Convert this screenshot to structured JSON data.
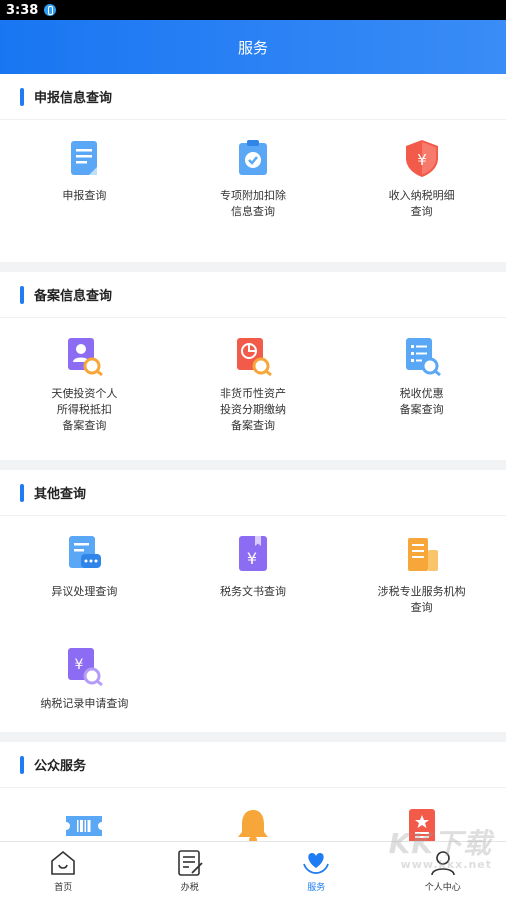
{
  "status": {
    "time": "3:38"
  },
  "header": {
    "title": "服务"
  },
  "sections": [
    {
      "title": "申报信息查询",
      "items": [
        {
          "label": "申报查询",
          "icon": "document-icon"
        },
        {
          "label": "专项附加扣除\n信息查询",
          "icon": "clipboard-check-icon"
        },
        {
          "label": "收入纳税明细\n查询",
          "icon": "shield-yen-icon"
        }
      ]
    },
    {
      "title": "备案信息查询",
      "items": [
        {
          "label": "天使投资个人\n所得税抵扣\n备案查询",
          "icon": "person-search-icon"
        },
        {
          "label": "非货币性资产\n投资分期缴纳\n备案查询",
          "icon": "pie-search-icon"
        },
        {
          "label": "税收优惠\n备案查询",
          "icon": "list-search-icon"
        }
      ]
    },
    {
      "title": "其他查询",
      "items": [
        {
          "label": "异议处理查询",
          "icon": "chat-document-icon"
        },
        {
          "label": "税务文书查询",
          "icon": "yen-book-icon"
        },
        {
          "label": "涉税专业服务机构\n查询",
          "icon": "building-icon"
        },
        {
          "label": "纳税记录申请查询",
          "icon": "yen-search-icon"
        }
      ]
    },
    {
      "title": "公众服务",
      "items": [
        {
          "label": "",
          "icon": "ticket-barcode-icon"
        },
        {
          "label": "",
          "icon": "bell-icon"
        },
        {
          "label": "",
          "icon": "star-document-icon"
        }
      ]
    }
  ],
  "tabs": [
    {
      "label": "首页",
      "icon": "home-icon"
    },
    {
      "label": "办税",
      "icon": "edit-document-icon"
    },
    {
      "label": "服务",
      "icon": "heart-hands-icon"
    },
    {
      "label": "个人中心",
      "icon": "user-icon"
    }
  ],
  "watermark": {
    "brand": "KK下载",
    "site": "www.kkx.net"
  }
}
